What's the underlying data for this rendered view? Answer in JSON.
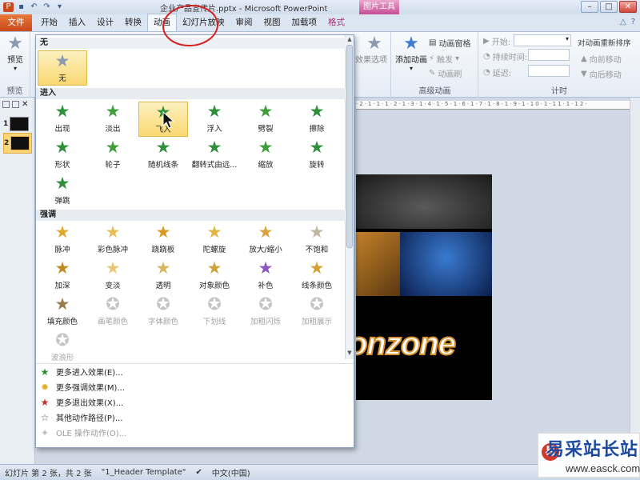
{
  "titlebar": {
    "title": "企业产品宣传片.pptx - Microsoft PowerPoint",
    "context_tools_label": "图片工具",
    "quick_access": [
      "save-icon",
      "undo-icon",
      "redo-icon",
      "customize-icon"
    ],
    "window_buttons": [
      "minimize",
      "maximize",
      "close"
    ]
  },
  "tabs": {
    "file": "文件",
    "items": [
      "开始",
      "插入",
      "设计",
      "转换",
      "动画",
      "幻灯片放映",
      "审阅",
      "视图",
      "加载项"
    ],
    "active": "动画",
    "context_tab": "格式"
  },
  "ribbon": {
    "preview": {
      "button": "预览",
      "group": "预览"
    },
    "effect_options": "效果选项",
    "advanced": {
      "add_animation": "添加动画",
      "animation_pane": "动画窗格",
      "trigger": "触发",
      "animation_painter": "动画刷",
      "group": "高级动画"
    },
    "timing": {
      "start": "开始:",
      "duration": "持续时间:",
      "delay": "延迟:",
      "reorder": "对动画重新排序",
      "move_earlier": "向前移动",
      "move_later": "向后移动",
      "group": "计时"
    }
  },
  "gallery": {
    "none_section": "无",
    "none_item": "无",
    "entrance_section": "进入",
    "entrance": [
      "出现",
      "淡出",
      "飞入",
      "浮入",
      "劈裂",
      "擦除",
      "形状",
      "轮子",
      "随机线条",
      "翻转式由远...",
      "缩放",
      "旋转",
      "弹跳"
    ],
    "emphasis_section": "强调",
    "emphasis": [
      "脉冲",
      "彩色脉冲",
      "跷跷板",
      "陀螺旋",
      "放大/缩小",
      "不饱和",
      "加深",
      "变淡",
      "透明",
      "对象颜色",
      "补色",
      "线条颜色",
      "填充颜色",
      "画笔颜色",
      "字体颜色",
      "下划线",
      "加粗闪烁",
      "加粗展示",
      "波浪形"
    ],
    "footer": [
      {
        "label": "更多进入效果(E)...",
        "enabled": true
      },
      {
        "label": "更多强调效果(M)...",
        "enabled": true
      },
      {
        "label": "更多退出效果(X)...",
        "enabled": true
      },
      {
        "label": "其他动作路径(P)...",
        "enabled": true
      },
      {
        "label": "OLE 操作动作(O)...",
        "enabled": false
      }
    ],
    "selected": "飞入"
  },
  "slides": {
    "numbers": [
      "1",
      "2"
    ],
    "selected": "2"
  },
  "slide_preview": {
    "text": "onzone"
  },
  "statusbar": {
    "slide_info": "幻灯片 第 2 张，共 2 张",
    "theme": "\"1_Header Template\"",
    "language": "中文(中国)"
  },
  "watermark": {
    "name": "易采站长站",
    "url": "www.easck.com"
  },
  "colors": {
    "file_tab": "#d9582a",
    "context_tab": "#c54e93",
    "selection": "#f9d871",
    "annotation_circle": "#d32020"
  }
}
